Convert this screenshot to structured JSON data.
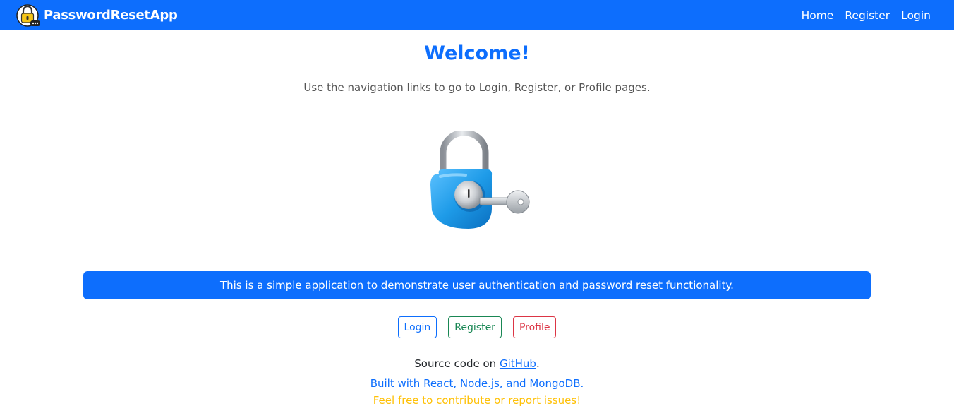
{
  "navbar": {
    "brand": "PasswordResetApp",
    "links": [
      "Home",
      "Register",
      "Login"
    ]
  },
  "main": {
    "title": "Welcome!",
    "subtitle": "Use the navigation links to go to Login, Register, or Profile pages.",
    "hero_icon": "unlocked-padlock-with-key",
    "info_text": "This is a simple application to demonstrate user authentication and password reset functionality.",
    "buttons": {
      "login": "Login",
      "register": "Register",
      "profile": "Profile"
    },
    "footer": {
      "source_prefix": "Source code on ",
      "source_link": "GitHub",
      "source_suffix": ".",
      "built_with": "Built with React, Node.js, and MongoDB.",
      "contribute": "Feel free to contribute or report issues!"
    }
  },
  "colors": {
    "primary": "#0d6efd",
    "success": "#198754",
    "danger": "#dc3545",
    "warning": "#ffc107"
  }
}
